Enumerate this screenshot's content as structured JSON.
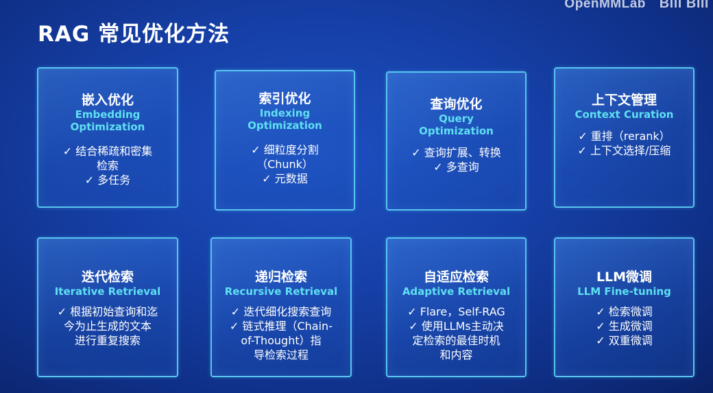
{
  "watermark": {
    "left": "OpenMMLab",
    "right": "Bili Bili"
  },
  "title": "RAG 常见优化方法",
  "cards": [
    {
      "title": "嵌入优化",
      "subtitle_lines": [
        "Embedding",
        "Optimization"
      ],
      "items": [
        "✓ 结合稀疏和密集",
        "检索",
        "✓ 多任务"
      ]
    },
    {
      "title": "索引优化",
      "subtitle_lines": [
        "Indexing",
        "Optimization"
      ],
      "items": [
        "✓ 细粒度分割",
        "（Chunk）",
        "✓ 元数据"
      ]
    },
    {
      "title": "查询优化",
      "subtitle_lines": [
        "Query",
        "Optimization"
      ],
      "items": [
        "✓ 查询扩展、转换",
        "✓ 多查询"
      ]
    },
    {
      "title": "上下文管理",
      "subtitle_lines": [
        "Context Curation"
      ],
      "items": [
        "✓ 重排（rerank）",
        "✓ 上下文选择/压缩"
      ]
    },
    {
      "title": "迭代检索",
      "subtitle_lines": [
        "Iterative Retrieval"
      ],
      "items": [
        "✓ 根据初始查询和迄",
        "今为止生成的文本",
        "进行重复搜索"
      ]
    },
    {
      "title": "递归检索",
      "subtitle_lines": [
        "Recursive Retrieval"
      ],
      "items": [
        "✓ 迭代细化搜索查询",
        "✓ 链式推理（Chain-",
        "of-Thought）指",
        "导检索过程"
      ]
    },
    {
      "title": "自适应检索",
      "subtitle_lines": [
        "Adaptive Retrieval"
      ],
      "items": [
        "✓ Flare，Self-RAG",
        "✓ 使用LLMs主动决",
        "定检索的最佳时机",
        "和内容"
      ]
    },
    {
      "title": "LLM微调",
      "subtitle_lines": [
        "LLM Fine-tuning"
      ],
      "items": [
        "✓ 检索微调",
        "✓ 生成微调",
        "✓ 双重微调"
      ]
    }
  ]
}
